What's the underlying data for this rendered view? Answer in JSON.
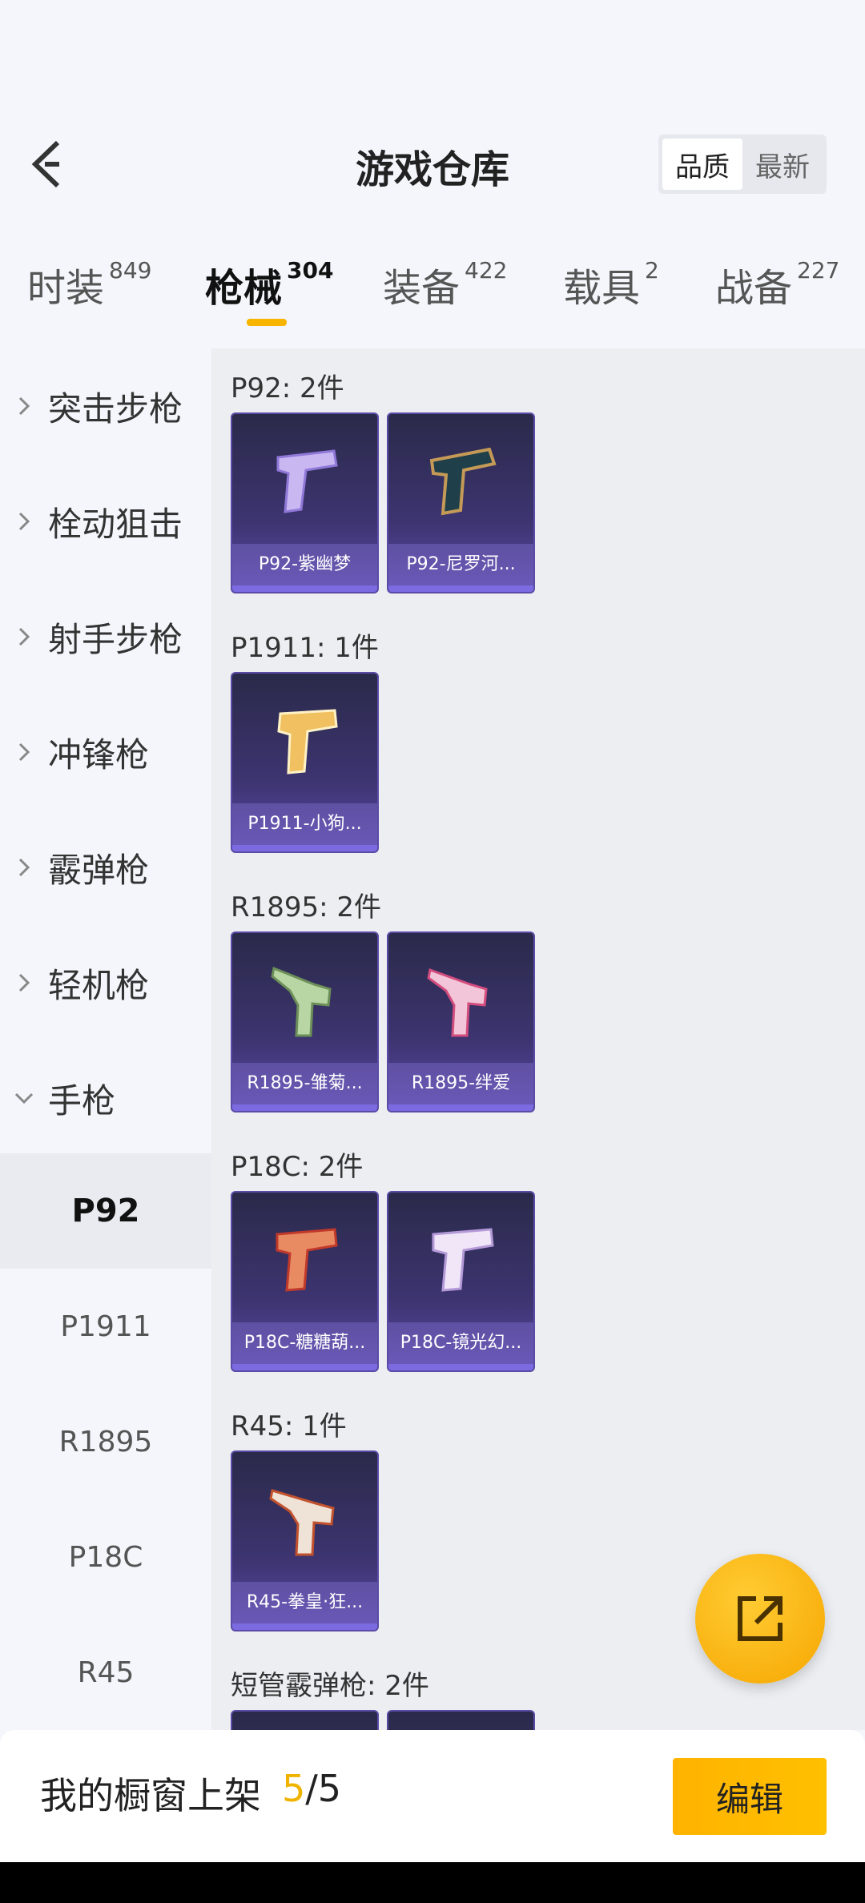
{
  "header": {
    "title": "游戏仓库",
    "sort_quality": "品质",
    "sort_newest": "最新"
  },
  "tabs": [
    {
      "label": "时装",
      "count": "849"
    },
    {
      "label": "枪械",
      "count": "304"
    },
    {
      "label": "装备",
      "count": "422"
    },
    {
      "label": "载具",
      "count": "2"
    },
    {
      "label": "战备",
      "count": "227"
    }
  ],
  "sidebar": {
    "categories": [
      "突击步枪",
      "栓动狙击",
      "射手步枪",
      "冲锋枪",
      "霰弹枪",
      "轻机枪",
      "手枪"
    ],
    "subitems": [
      "P92",
      "P1911",
      "R1895",
      "P18C",
      "R45"
    ]
  },
  "groups": [
    {
      "title": "P92: 2件",
      "items": [
        "P92-紫幽梦",
        "P92-尼罗河..."
      ]
    },
    {
      "title": "P1911: 1件",
      "items": [
        "P1911-小狗..."
      ]
    },
    {
      "title": "R1895: 2件",
      "items": [
        "R1895-雏菊...",
        "R1895-绊爱"
      ]
    },
    {
      "title": "P18C: 2件",
      "items": [
        "P18C-糖糖葫...",
        "P18C-镜光幻..."
      ]
    },
    {
      "title": "R45: 1件",
      "items": [
        "R45-拳皇·狂..."
      ]
    },
    {
      "title": "短管霰弹枪: 2件",
      "items": [
        "",
        ""
      ]
    }
  ],
  "bottom": {
    "label": "我的橱窗上架",
    "count_current": "5",
    "count_total": "/5",
    "edit_label": "编辑"
  },
  "colors": {
    "accent": "#f7b500",
    "card_bg": "#3d3470"
  }
}
